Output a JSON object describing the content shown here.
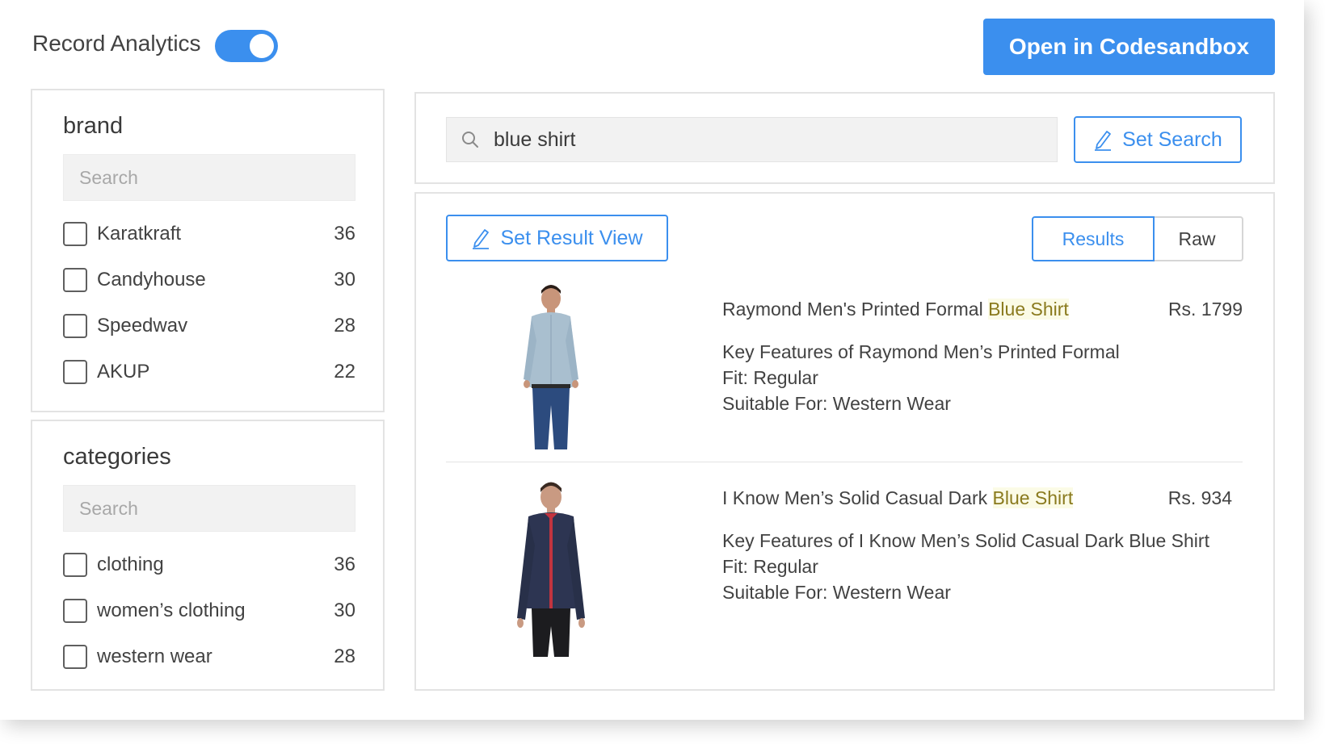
{
  "header": {
    "record_analytics_label": "Record Analytics",
    "record_analytics_enabled": true,
    "open_button_label": "Open in Codesandbox"
  },
  "facets": {
    "brand": {
      "title": "brand",
      "search_placeholder": "Search",
      "items": [
        {
          "label": "Karatkraft",
          "count": "36"
        },
        {
          "label": "Candyhouse",
          "count": "30"
        },
        {
          "label": "Speedwav",
          "count": "28"
        },
        {
          "label": "AKUP",
          "count": "22"
        }
      ]
    },
    "categories": {
      "title": "categories",
      "search_placeholder": "Search",
      "items": [
        {
          "label": "clothing",
          "count": "36"
        },
        {
          "label": "women’s clothing",
          "count": "30"
        },
        {
          "label": "western wear",
          "count": "28"
        }
      ]
    }
  },
  "search": {
    "value": "blue shirt",
    "set_search_label": "Set Search"
  },
  "results_view": {
    "set_result_view_label": "Set Result View",
    "tabs": [
      {
        "label": "Results",
        "active": true
      },
      {
        "label": "Raw",
        "active": false
      }
    ]
  },
  "results": [
    {
      "title_prefix": "Raymond Men's Printed Formal ",
      "title_highlight": "Blue Shirt",
      "price": "Rs. 1799",
      "desc_lines": [
        "Key Features of Raymond Men’s Printed Formal",
        "Fit: Regular",
        "Suitable For: Western Wear"
      ],
      "image": "man-light-blue-shirt"
    },
    {
      "title_prefix": "I Know Men’s Solid Casual Dark ",
      "title_highlight": "Blue Shirt",
      "price": "Rs. 934",
      "desc_lines": [
        "Key Features of I Know Men’s Solid Casual Dark Blue Shirt",
        "Fit: Regular",
        "Suitable For: Western Wear"
      ],
      "image": "man-dark-blue-shirt"
    }
  ],
  "colors": {
    "accent": "#3b8fee",
    "highlight_bg": "#fbfbe6",
    "highlight_text": "#8a7a1e"
  },
  "icons": {
    "search": "search-icon",
    "edit": "pencil-icon"
  }
}
